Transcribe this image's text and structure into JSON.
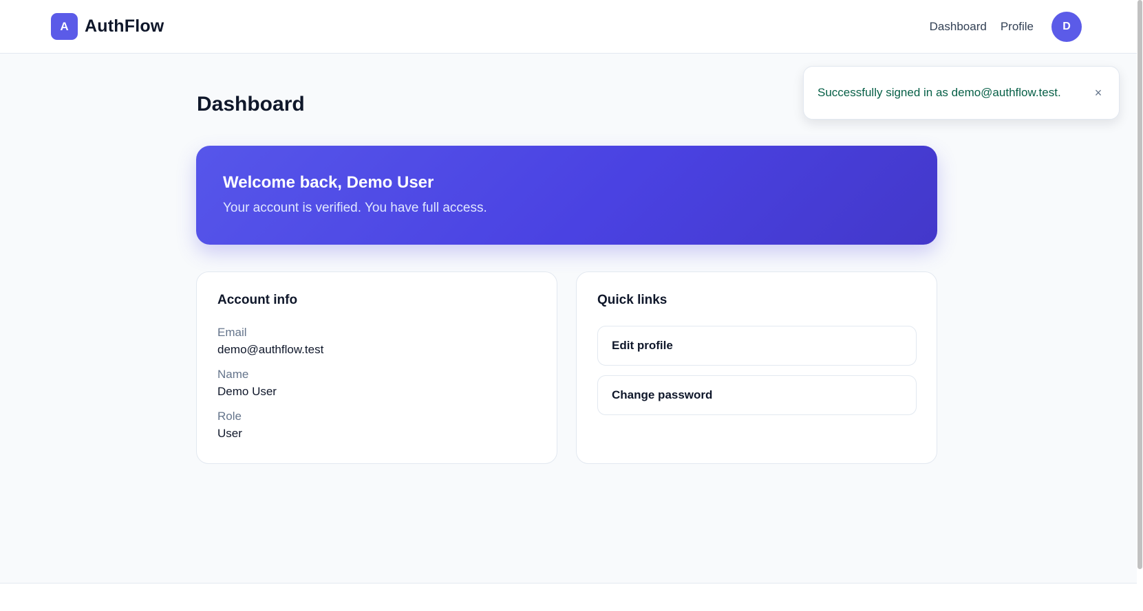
{
  "header": {
    "brand_initial": "A",
    "brand_name": "AuthFlow",
    "nav": [
      {
        "label": "Dashboard"
      },
      {
        "label": "Profile"
      }
    ],
    "avatar_initial": "D"
  },
  "toast": {
    "message": "Successfully signed in as demo@authflow.test.",
    "close_symbol": "×"
  },
  "main": {
    "title": "Dashboard",
    "hero": {
      "title": "Welcome back, Demo User",
      "subtitle": "Your account is verified. You have full access."
    },
    "account": {
      "title": "Account info",
      "fields": [
        {
          "label": "Email",
          "value": "demo@authflow.test"
        },
        {
          "label": "Name",
          "value": "Demo User"
        },
        {
          "label": "Role",
          "value": "User"
        }
      ]
    },
    "quick_links": {
      "title": "Quick links",
      "items": [
        {
          "label": "Edit profile"
        },
        {
          "label": "Change password"
        }
      ]
    }
  },
  "colors": {
    "accent": "#5b5be8",
    "success_text": "#065f46",
    "page_background": "#f8fafc"
  },
  "icons": {
    "toast_close": "close-icon"
  }
}
